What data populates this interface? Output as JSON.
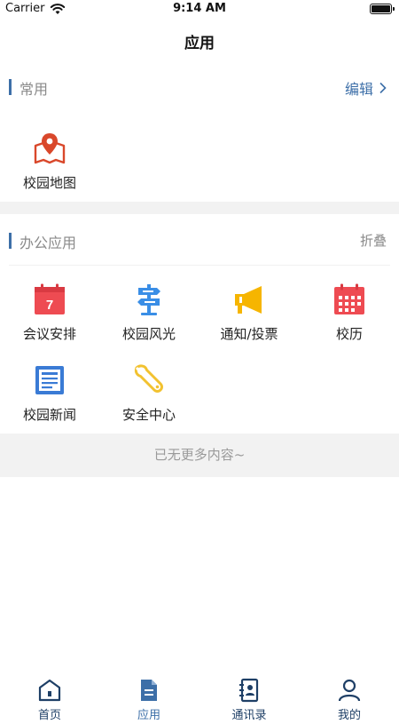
{
  "status_bar": {
    "carrier": "Carrier",
    "time": "9:14 AM"
  },
  "nav": {
    "title": "应用"
  },
  "frequent": {
    "title": "常用",
    "action": "编辑",
    "apps": [
      {
        "label": "校园地图",
        "icon": "map-pin-icon"
      }
    ]
  },
  "office": {
    "title": "办公应用",
    "action": "折叠",
    "apps": [
      {
        "label": "会议安排",
        "icon": "calendar-seven-icon"
      },
      {
        "label": "校园风光",
        "icon": "signpost-icon"
      },
      {
        "label": "通知/投票",
        "icon": "megaphone-icon"
      },
      {
        "label": "校历",
        "icon": "calendar-grid-icon"
      },
      {
        "label": "校园新闻",
        "icon": "newspaper-icon"
      },
      {
        "label": "安全中心",
        "icon": "wrench-icon"
      }
    ]
  },
  "calendar_badge": "7",
  "no_more": "已无更多内容~",
  "tabs": [
    {
      "label": "首页",
      "icon": "home-icon"
    },
    {
      "label": "应用",
      "icon": "document-icon",
      "active": true
    },
    {
      "label": "通讯录",
      "icon": "contacts-book-icon"
    },
    {
      "label": "我的",
      "icon": "user-icon"
    }
  ],
  "colors": {
    "accent": "#3d6fa8",
    "section_bg": "#f2f2f2",
    "map_red": "#d9482b",
    "calendar_red": "#ee4b52",
    "signpost_blue": "#3a8ee6",
    "megaphone_yellow": "#f6b500",
    "news_blue": "#3a7bd5",
    "wrench_yellow": "#f2c230",
    "tab_navy": "#1e3f66"
  }
}
